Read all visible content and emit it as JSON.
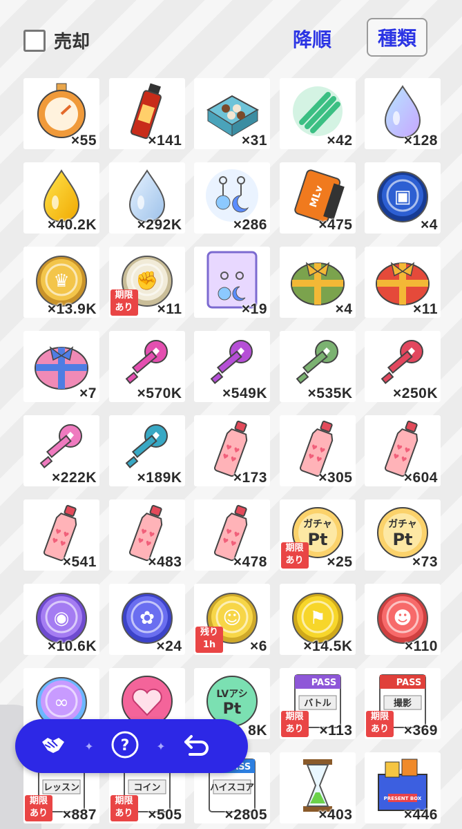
{
  "header": {
    "sell_label": "売却",
    "sort_label": "降順",
    "kind_label": "種類"
  },
  "items": [
    {
      "icon": "stopwatch-icon",
      "qty": "×55",
      "badge": ""
    },
    {
      "icon": "energy-drink-icon",
      "qty": "×141",
      "badge": ""
    },
    {
      "icon": "chocolate-box-icon",
      "qty": "×31",
      "badge": ""
    },
    {
      "icon": "scroll-icon",
      "qty": "×42",
      "badge": ""
    },
    {
      "icon": "rainbow-drop-icon",
      "qty": "×128",
      "badge": ""
    },
    {
      "icon": "gold-drop-icon",
      "qty": "×40.2K",
      "badge": ""
    },
    {
      "icon": "silver-drop-icon",
      "qty": "×292K",
      "badge": ""
    },
    {
      "icon": "earring-icon",
      "qty": "×286",
      "badge": ""
    },
    {
      "icon": "film-icon",
      "qty": "×475",
      "badge": ""
    },
    {
      "icon": "photo-coin-icon",
      "qty": "×4",
      "badge": ""
    },
    {
      "icon": "crown-coin-icon",
      "qty": "×13.9K",
      "badge": ""
    },
    {
      "icon": "fist-coin-icon",
      "qty": "×11",
      "badge": "期限\nあり"
    },
    {
      "icon": "earring-card-icon",
      "qty": "×19",
      "badge": ""
    },
    {
      "icon": "green-gift-icon",
      "qty": "×4",
      "badge": ""
    },
    {
      "icon": "red-gift-icon",
      "qty": "×11",
      "badge": ""
    },
    {
      "icon": "pink-gift-icon",
      "qty": "×7",
      "badge": ""
    },
    {
      "icon": "magenta-key-icon",
      "qty": "×570K",
      "badge": ""
    },
    {
      "icon": "purple-key-icon",
      "qty": "×549K",
      "badge": ""
    },
    {
      "icon": "green-key-icon",
      "qty": "×535K",
      "badge": ""
    },
    {
      "icon": "red-key-icon",
      "qty": "×250K",
      "badge": ""
    },
    {
      "icon": "pink-key-icon",
      "qty": "×222K",
      "badge": ""
    },
    {
      "icon": "teal-key-icon",
      "qty": "×189K",
      "badge": ""
    },
    {
      "icon": "pink-bottle-icon",
      "qty": "×173",
      "badge": ""
    },
    {
      "icon": "pink-bottle-icon",
      "qty": "×305",
      "badge": ""
    },
    {
      "icon": "pink-bottle-icon",
      "qty": "×604",
      "badge": ""
    },
    {
      "icon": "pink-bottle-icon",
      "qty": "×541",
      "badge": ""
    },
    {
      "icon": "pink-bottle-icon",
      "qty": "×483",
      "badge": ""
    },
    {
      "icon": "pink-bottle-icon",
      "qty": "×478",
      "badge": ""
    },
    {
      "icon": "gacha-pt-icon",
      "qty": "×25",
      "badge": "期限\nあり",
      "text1": "ガチャ",
      "text2": "Pt"
    },
    {
      "icon": "gacha-pt-icon",
      "qty": "×73",
      "badge": "",
      "text1": "ガチャ",
      "text2": "Pt"
    },
    {
      "icon": "monkey-coin-icon",
      "qty": "×10.6K",
      "badge": ""
    },
    {
      "icon": "flower-coin-icon",
      "qty": "×24",
      "badge": ""
    },
    {
      "icon": "person-coin-icon",
      "qty": "×6",
      "badge": "残り\n1h"
    },
    {
      "icon": "flag-coin-icon",
      "qty": "×14.5K",
      "badge": ""
    },
    {
      "icon": "user-coin-icon",
      "qty": "×110",
      "badge": ""
    },
    {
      "icon": "rainbow-coin-icon",
      "qty": "",
      "badge": ""
    },
    {
      "icon": "heart-badge-icon",
      "qty": "",
      "badge": ""
    },
    {
      "icon": "lv-pt-icon",
      "qty": "8K",
      "badge": "",
      "text1": "LVアシ",
      "text2": "Pt"
    },
    {
      "icon": "pass-battle-icon",
      "qty": "×113",
      "badge": "期限\nあり",
      "text1": "PASS",
      "text2": "バトル"
    },
    {
      "icon": "pass-photo-icon",
      "qty": "×369",
      "badge": "期限\nあり",
      "text1": "PASS",
      "text2": "撮影"
    },
    {
      "icon": "pass-lesson-icon",
      "qty": "×887",
      "badge": "期限\nあり",
      "text1": "",
      "text2": "レッスン"
    },
    {
      "icon": "pass-coin-icon",
      "qty": "×505",
      "badge": "期限\nあり",
      "text1": "",
      "text2": "コイン"
    },
    {
      "icon": "pass-highscore-icon",
      "qty": "×2805",
      "badge": "",
      "text1": "PASS",
      "text2": "ハイスコア"
    },
    {
      "icon": "hourglass-icon",
      "qty": "×403",
      "badge": ""
    },
    {
      "icon": "present-box-icon",
      "qty": "×446",
      "badge": "",
      "text1": "PRESENT BOX"
    }
  ],
  "toolbar": {
    "buttons": [
      {
        "name": "handshake-button",
        "icon": "handshake-icon"
      },
      {
        "name": "help-button",
        "icon": "help-icon"
      },
      {
        "name": "back-button",
        "icon": "back-arrow-icon"
      }
    ],
    "separator": "✦",
    "colors": {
      "background": "#2d28e6",
      "separator": "#a9a9ff"
    }
  },
  "colors": {
    "accent_blue": "#2b34e4",
    "badge_red": "#e94545"
  }
}
